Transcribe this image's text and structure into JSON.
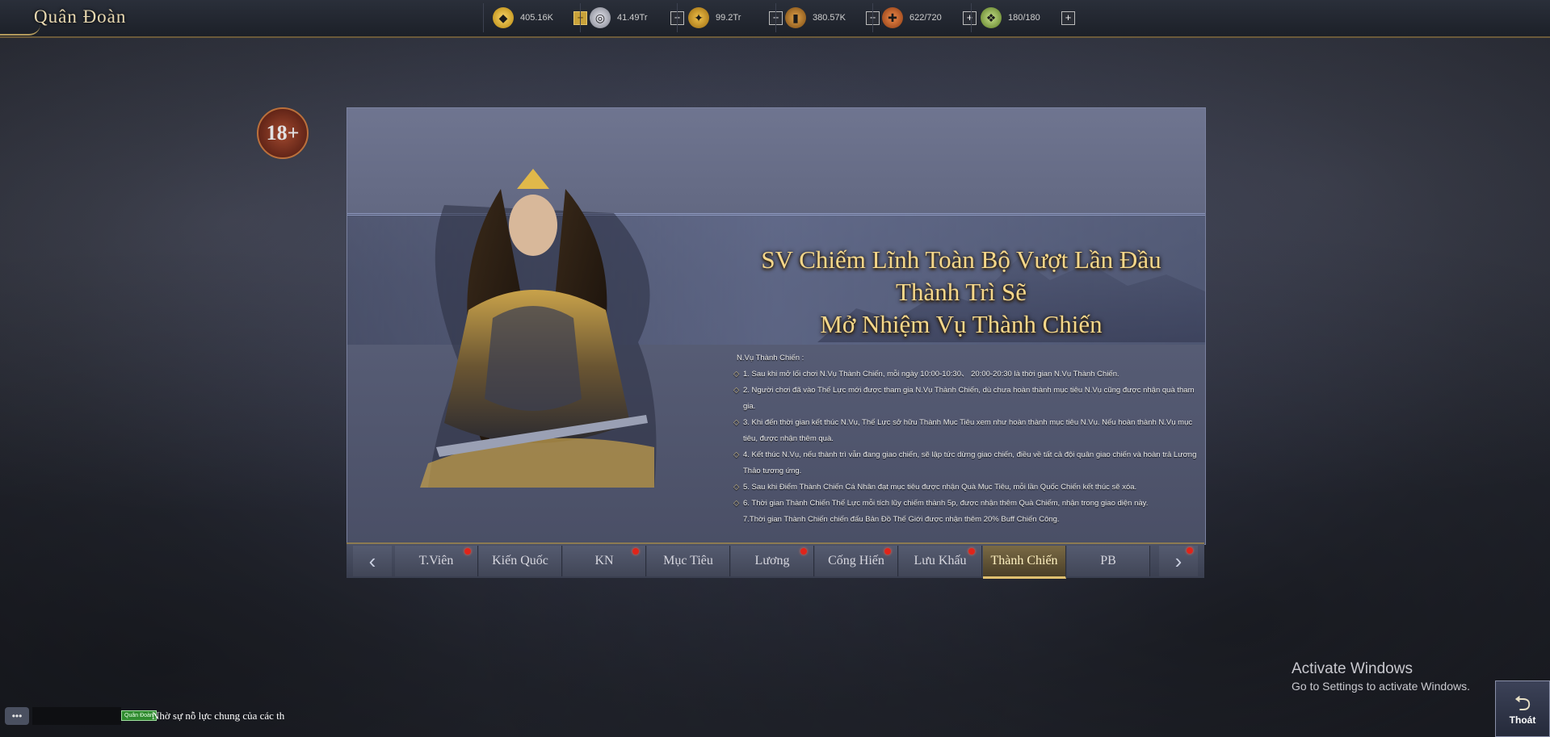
{
  "window": {
    "title": "Quân Đoàn",
    "age_badge": "18+"
  },
  "resources": [
    {
      "icon": "gold-ingot-icon",
      "value": "405.16K",
      "plus": "+"
    },
    {
      "icon": "silver-coin-icon",
      "value": "41.49Tr",
      "plus": "+"
    },
    {
      "icon": "grain-icon",
      "value": "99.2Tr",
      "plus": "+"
    },
    {
      "icon": "wood-icon",
      "value": "380.57K",
      "plus": "+"
    },
    {
      "icon": "scroll-icon",
      "value": "622/720",
      "plus": "+"
    },
    {
      "icon": "stamina-icon",
      "value": "180/180",
      "plus": "+"
    }
  ],
  "event": {
    "heading_line1": "SV Chiếm Lĩnh Toàn Bộ Vượt Lần Đầu Thành Trì Sẽ",
    "heading_line2": "Mở Nhiệm Vụ Thành Chiến",
    "rules_title": "N.Vụ Thành Chiến :",
    "rules": [
      "1. Sau khi mở lối chơi N.Vụ Thành Chiến, mỗi ngày 10:00-10:30、 20:00-20:30 là thời gian N.Vụ Thành Chiến.",
      "2. Người chơi đã vào Thế Lực mới được tham gia N.Vụ Thành Chiến, dù chưa hoàn thành mục tiêu N.Vụ cũng được nhận quà tham gia.",
      "3. Khi đến thời gian kết thúc N.Vụ, Thế Lực sở hữu Thành Mục Tiêu xem như hoàn thành mục tiêu N.Vụ. Nếu hoàn thành N.Vụ mục tiêu, được nhận thêm quà.",
      "4. Kết thúc N.Vụ, nếu thành trì vẫn đang giao chiến, sẽ lập tức dừng giao chiến, điều về tất cả đội quân giao chiến và hoàn trả Lương Thảo tương ứng.",
      "5. Sau khi Điểm Thành Chiến Cá Nhân đạt mục tiêu được nhận Quà Mục Tiêu, mỗi lần Quốc Chiến kết thúc sẽ xóa.",
      "6. Thời gian Thành Chiến Thế Lực mỗi tích lũy chiếm thành 5p, được nhận thêm Quà Chiếm, nhận trong giao diện này.",
      "7.Thời gian Thành Chiến chiến đấu Bản Đồ Thế Giới được nhận thêm  20% Buff Chiến Công."
    ]
  },
  "tabs": {
    "prev": "‹",
    "next": "›",
    "items": [
      {
        "label": "T.Viên",
        "dot": true,
        "active": false
      },
      {
        "label": "Kiến Quốc",
        "dot": false,
        "active": false
      },
      {
        "label": "KN",
        "dot": true,
        "active": false
      },
      {
        "label": "Mục Tiêu",
        "dot": false,
        "active": false
      },
      {
        "label": "Lương",
        "dot": true,
        "active": false
      },
      {
        "label": "Cống Hiến",
        "dot": true,
        "active": false
      },
      {
        "label": "Lưu Khấu",
        "dot": true,
        "active": false
      },
      {
        "label": "Thành Chiến",
        "dot": false,
        "active": true
      },
      {
        "label": "PB",
        "dot": false,
        "active": false
      }
    ]
  },
  "chat": {
    "button": "•••",
    "tag": "Quân Đoàn",
    "message": "Nhờ sự nỗ lực chung của các th"
  },
  "watermark": {
    "line1": "Activate Windows",
    "line2": "Go to Settings to activate Windows."
  },
  "exit": {
    "icon": "return-arrow-icon",
    "label": "Thoát"
  },
  "colors": {
    "accent_gold": "#f5d78a",
    "notification_red": "#e0241a",
    "chat_tag_green": "#2f8a2f"
  }
}
